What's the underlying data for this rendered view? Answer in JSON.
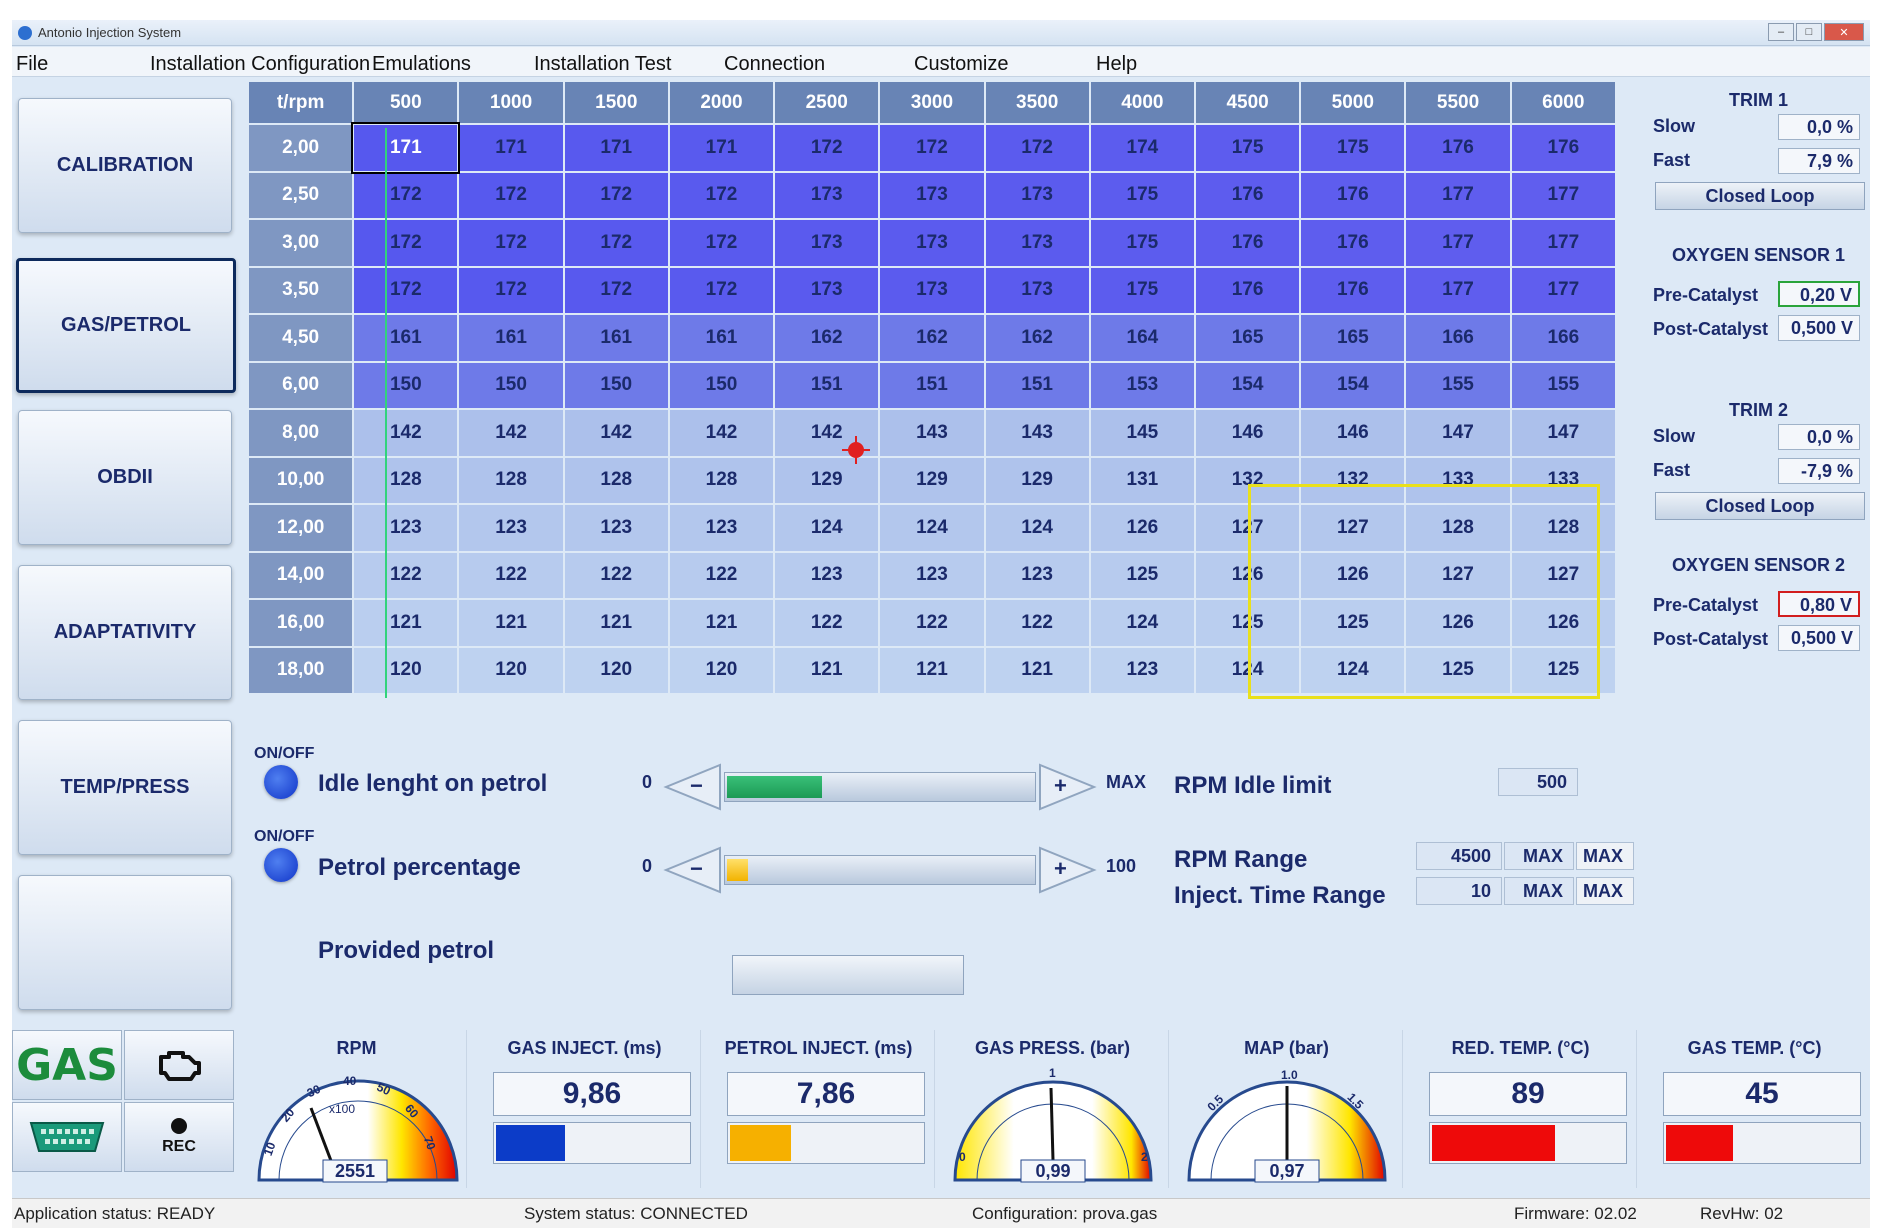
{
  "window": {
    "title": "Antonio Injection System",
    "controls": [
      "–",
      "□",
      "✕"
    ]
  },
  "menu": [
    "File",
    "Installation Configuration",
    "Emulations",
    "Installation Test",
    "Connection",
    "Customize",
    "Help"
  ],
  "nav": [
    "CALIBRATION",
    "GAS/PETROL",
    "OBDII",
    "ADAPTATIVITY",
    "TEMP/PRESS",
    ""
  ],
  "tiles": {
    "gas": "GAS",
    "rec": "REC"
  },
  "map": {
    "corner": "t/rpm",
    "rpm": [
      "500",
      "1000",
      "1500",
      "2000",
      "2500",
      "3000",
      "3500",
      "4000",
      "4500",
      "5000",
      "5500",
      "6000"
    ],
    "rows": [
      {
        "t": "2,00",
        "v": [
          "171",
          "171",
          "171",
          "171",
          "172",
          "172",
          "172",
          "174",
          "175",
          "175",
          "176",
          "176"
        ]
      },
      {
        "t": "2,50",
        "v": [
          "172",
          "172",
          "172",
          "172",
          "173",
          "173",
          "173",
          "175",
          "176",
          "176",
          "177",
          "177"
        ]
      },
      {
        "t": "3,00",
        "v": [
          "172",
          "172",
          "172",
          "172",
          "173",
          "173",
          "173",
          "175",
          "176",
          "176",
          "177",
          "177"
        ]
      },
      {
        "t": "3,50",
        "v": [
          "172",
          "172",
          "172",
          "172",
          "173",
          "173",
          "173",
          "175",
          "176",
          "176",
          "177",
          "177"
        ]
      },
      {
        "t": "4,50",
        "v": [
          "161",
          "161",
          "161",
          "161",
          "162",
          "162",
          "162",
          "164",
          "165",
          "165",
          "166",
          "166"
        ]
      },
      {
        "t": "6,00",
        "v": [
          "150",
          "150",
          "150",
          "150",
          "151",
          "151",
          "151",
          "153",
          "154",
          "154",
          "155",
          "155"
        ]
      },
      {
        "t": "8,00",
        "v": [
          "142",
          "142",
          "142",
          "142",
          "142",
          "143",
          "143",
          "145",
          "146",
          "146",
          "147",
          "147"
        ]
      },
      {
        "t": "10,00",
        "v": [
          "128",
          "128",
          "128",
          "128",
          "129",
          "129",
          "129",
          "131",
          "132",
          "132",
          "133",
          "133"
        ]
      },
      {
        "t": "12,00",
        "v": [
          "123",
          "123",
          "123",
          "123",
          "124",
          "124",
          "124",
          "126",
          "127",
          "127",
          "128",
          "128"
        ]
      },
      {
        "t": "14,00",
        "v": [
          "122",
          "122",
          "122",
          "122",
          "123",
          "123",
          "123",
          "125",
          "126",
          "126",
          "127",
          "127"
        ]
      },
      {
        "t": "16,00",
        "v": [
          "121",
          "121",
          "121",
          "121",
          "122",
          "122",
          "122",
          "124",
          "125",
          "125",
          "126",
          "126"
        ]
      },
      {
        "t": "18,00",
        "v": [
          "120",
          "120",
          "120",
          "120",
          "121",
          "121",
          "121",
          "123",
          "124",
          "124",
          "125",
          "125"
        ]
      }
    ]
  },
  "controls": {
    "on_off": "ON/OFF",
    "idle_label": "Idle lenght on petrol",
    "idle_min": "0",
    "idle_max": "MAX",
    "idle_level": 0.32,
    "petrol_label": "Petrol  percentage",
    "petrol_min": "0",
    "petrol_max": "100",
    "petrol_level": 0.08,
    "provided_label": "Provided petrol",
    "minus": "−",
    "plus": "+",
    "rpm_idle_label": "RPM Idle limit",
    "rpm_idle_value": "500",
    "rpm_range_label": "RPM Range",
    "rpm_range_value": "4500",
    "inject_range_label": "Inject. Time Range",
    "inject_range_value": "10",
    "max": "MAX"
  },
  "right": {
    "trim1": {
      "title": "TRIM 1",
      "slow_label": "Slow",
      "slow": "0,0 %",
      "fast_label": "Fast",
      "fast": "7,9 %",
      "loop": "Closed Loop"
    },
    "oxy1": {
      "title": "OXYGEN SENSOR 1",
      "pre_label": "Pre-Catalyst",
      "pre": "0,20 V",
      "post_label": "Post-Catalyst",
      "post": "0,500 V"
    },
    "trim2": {
      "title": "TRIM 2",
      "slow_label": "Slow",
      "slow": "0,0 %",
      "fast_label": "Fast",
      "fast": "-7,9 %",
      "loop": "Closed Loop"
    },
    "oxy2": {
      "title": "OXYGEN SENSOR 2",
      "pre_label": "Pre-Catalyst",
      "pre": "0,80 V",
      "post_label": "Post-Catalyst",
      "post": "0,500 V"
    }
  },
  "gauges": {
    "rpm": {
      "title": "RPM",
      "value": "2551",
      "unit": "x100",
      "ticks": [
        "10",
        "20",
        "30",
        "40",
        "50",
        "60",
        "70"
      ]
    },
    "gas_inject": {
      "title": "GAS INJECT. (ms)",
      "value": "9,86",
      "level": 0.37,
      "color": "#0c3cc8"
    },
    "petrol_inject": {
      "title": "PETROL INJECT. (ms)",
      "value": "7,86",
      "level": 0.33,
      "color": "#f6b000"
    },
    "gas_press": {
      "title": "GAS PRESS. (bar)",
      "value": "0,99",
      "ticks": [
        "0",
        "1",
        "2"
      ]
    },
    "map": {
      "title": "MAP (bar)",
      "value": "0,97",
      "ticks": [
        "0.5",
        "1.0",
        "1.5"
      ]
    },
    "red_temp": {
      "title": "RED. TEMP. (°C)",
      "value": "89",
      "level": 0.65,
      "color": "#ee0a0a"
    },
    "gas_temp": {
      "title": "GAS TEMP. (°C)",
      "value": "45",
      "level": 0.36,
      "color": "#ee0a0a"
    }
  },
  "status": {
    "app": "Application status: READY",
    "system": "System status: CONNECTED",
    "config": "Configuration: prova.gas",
    "firmware": "Firmware: 02.02",
    "revhw": "RevHw: 02"
  }
}
